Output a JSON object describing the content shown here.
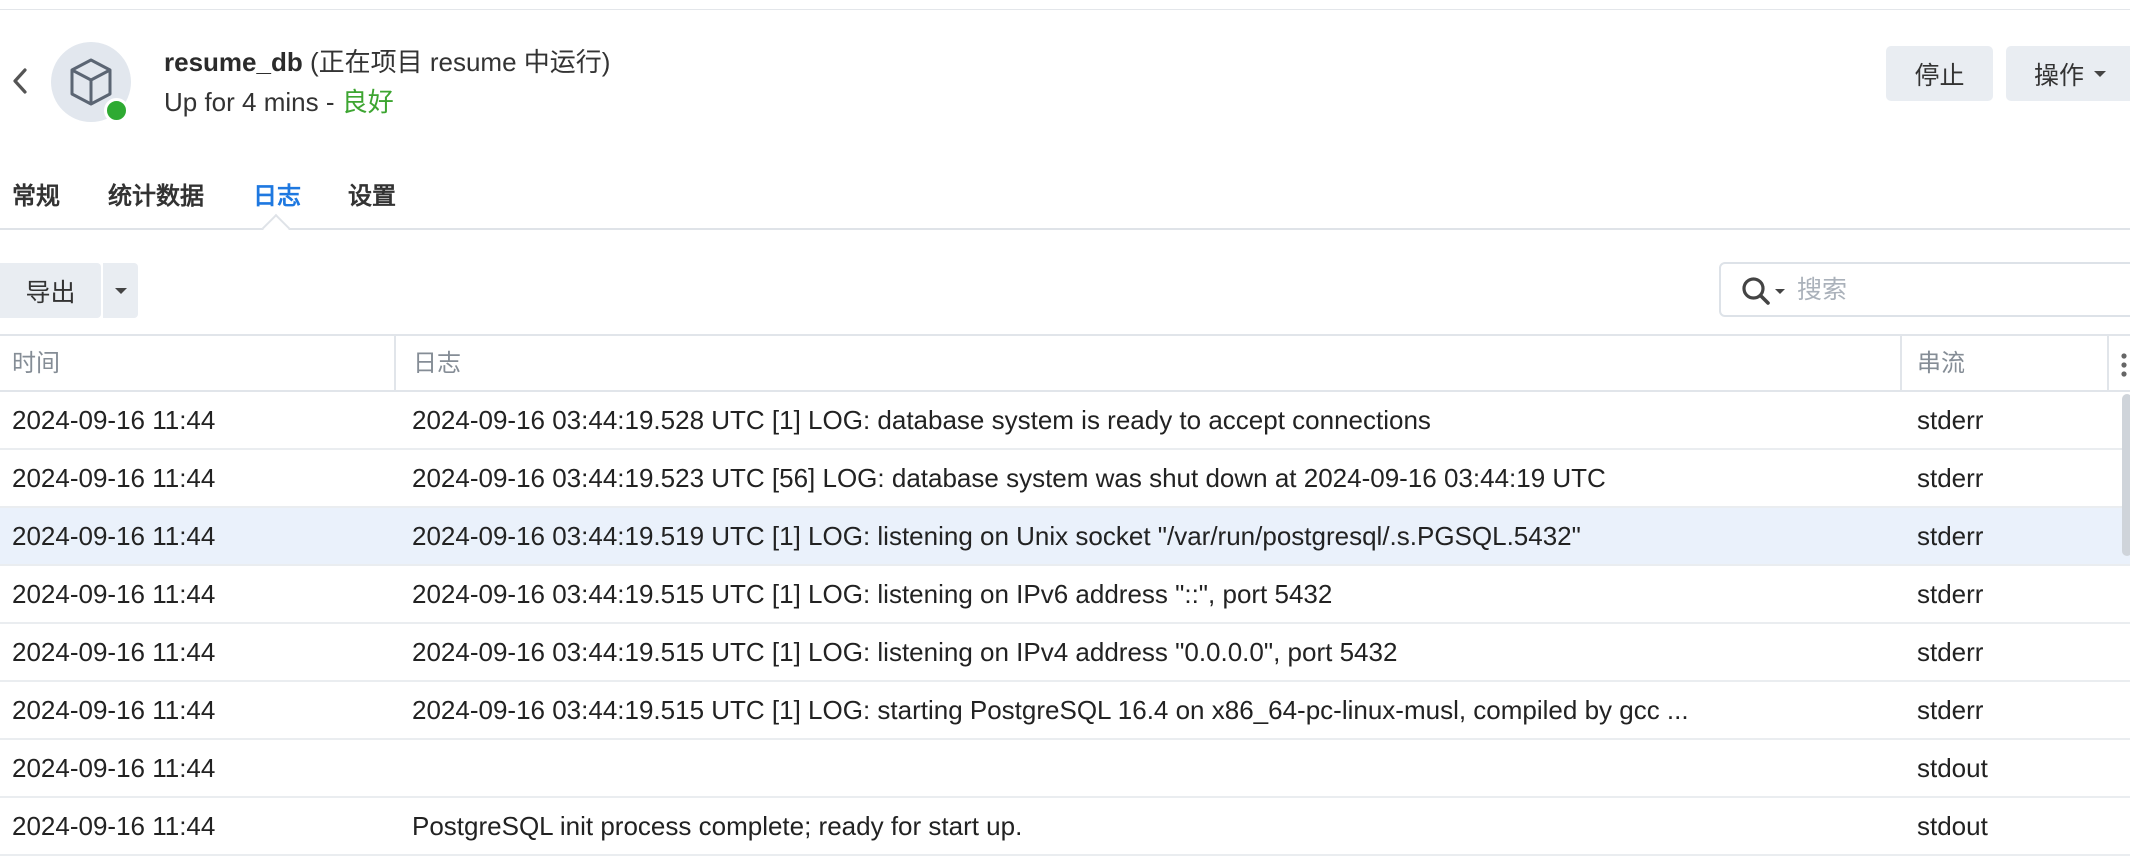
{
  "header": {
    "container_name": "resume_db",
    "project_note": "(正在项目 resume 中运行)",
    "uptime": "Up for 4 mins - ",
    "health": "良好",
    "stop_label": "停止",
    "actions_label": "操作"
  },
  "tabs": [
    {
      "label": "常规"
    },
    {
      "label": "统计数据"
    },
    {
      "label": "日志"
    },
    {
      "label": "设置"
    }
  ],
  "active_tab": "日志",
  "toolbar": {
    "export_label": "导出",
    "search_placeholder": "搜索"
  },
  "table": {
    "columns": [
      "时间",
      "日志",
      "串流"
    ],
    "rows": [
      {
        "time": "2024-09-16 11:44",
        "log": "2024-09-16 03:44:19.528 UTC [1] LOG: database system is ready to accept connections",
        "stream": "stderr"
      },
      {
        "time": "2024-09-16 11:44",
        "log": "2024-09-16 03:44:19.523 UTC [56] LOG: database system was shut down at 2024-09-16 03:44:19 UTC",
        "stream": "stderr"
      },
      {
        "time": "2024-09-16 11:44",
        "log": "2024-09-16 03:44:19.519 UTC [1] LOG: listening on Unix socket \"/var/run/postgresql/.s.PGSQL.5432\"",
        "stream": "stderr"
      },
      {
        "time": "2024-09-16 11:44",
        "log": "2024-09-16 03:44:19.515 UTC [1] LOG: listening on IPv6 address \"::\", port 5432",
        "stream": "stderr"
      },
      {
        "time": "2024-09-16 11:44",
        "log": "2024-09-16 03:44:19.515 UTC [1] LOG: listening on IPv4 address \"0.0.0.0\", port 5432",
        "stream": "stderr"
      },
      {
        "time": "2024-09-16 11:44",
        "log": "2024-09-16 03:44:19.515 UTC [1] LOG: starting PostgreSQL 16.4 on x86_64-pc-linux-musl, compiled by gcc ...",
        "stream": "stderr"
      },
      {
        "time": "2024-09-16 11:44",
        "log": "",
        "stream": "stdout"
      },
      {
        "time": "2024-09-16 11:44",
        "log": "PostgreSQL init process complete; ready for start up.",
        "stream": "stdout"
      }
    ],
    "selected_row": 2
  },
  "colors": {
    "accent": "#1e78e0",
    "health_ok": "#3da531",
    "status_dot": "#2eaa32",
    "selected_row_bg": "#eaf1fb"
  },
  "icons": {
    "back": "chevron-left-icon",
    "container": "cube-icon",
    "search": "search-icon",
    "dropdown": "caret-down-icon",
    "columns_menu": "more-vertical-icon"
  }
}
